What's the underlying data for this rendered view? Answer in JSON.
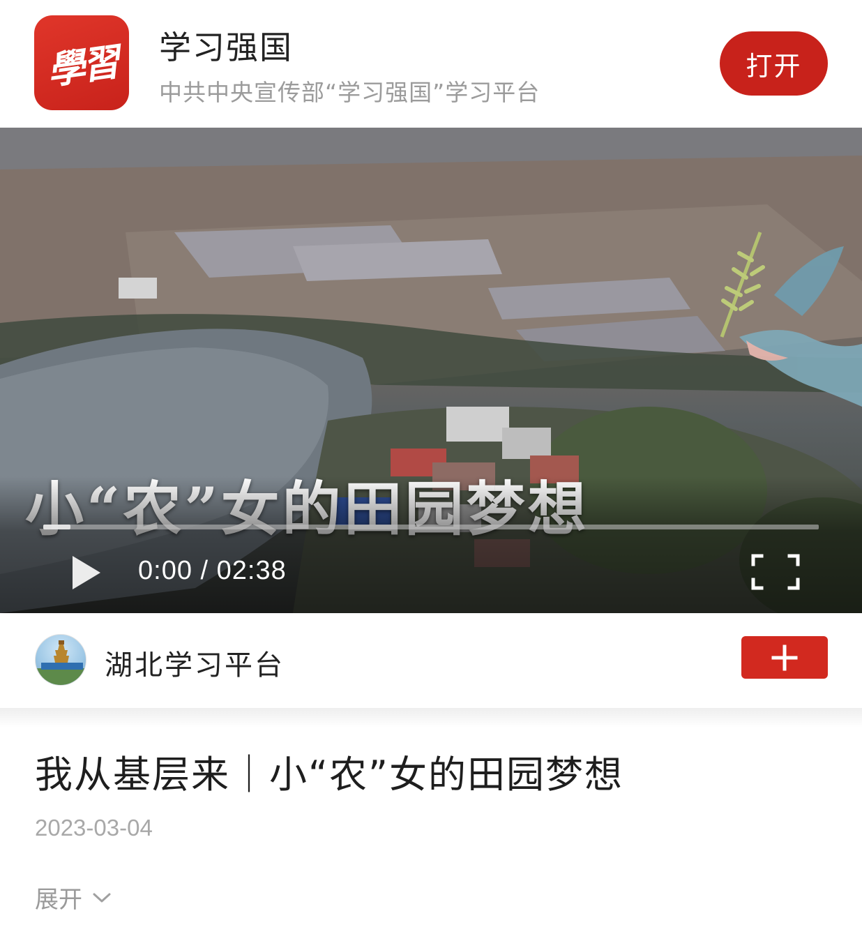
{
  "app_banner": {
    "logo_text": "學習",
    "name": "学习强国",
    "description": "中共中央宣传部“学习强国”学习平台",
    "open_button": "打开"
  },
  "video": {
    "overlay_title": "小“农”女的田园梦想",
    "current_time": "0:00",
    "duration": "02:38",
    "time_display": "0:00 / 02:38",
    "progress_fraction": 0.035,
    "icons": [
      "play-icon",
      "fullscreen-icon"
    ]
  },
  "channel": {
    "name": "湖北学习平台",
    "follow_icon": "plus-icon"
  },
  "article": {
    "title": "我从基层来｜小“农”女的田园梦想",
    "date": "2023-03-04",
    "expand_label": "展开",
    "expand_icon": "chevron-down-icon"
  },
  "colors": {
    "brand_red": "#c8221b",
    "follow_red": "#d2291f",
    "muted_text": "#9b9b9b"
  }
}
